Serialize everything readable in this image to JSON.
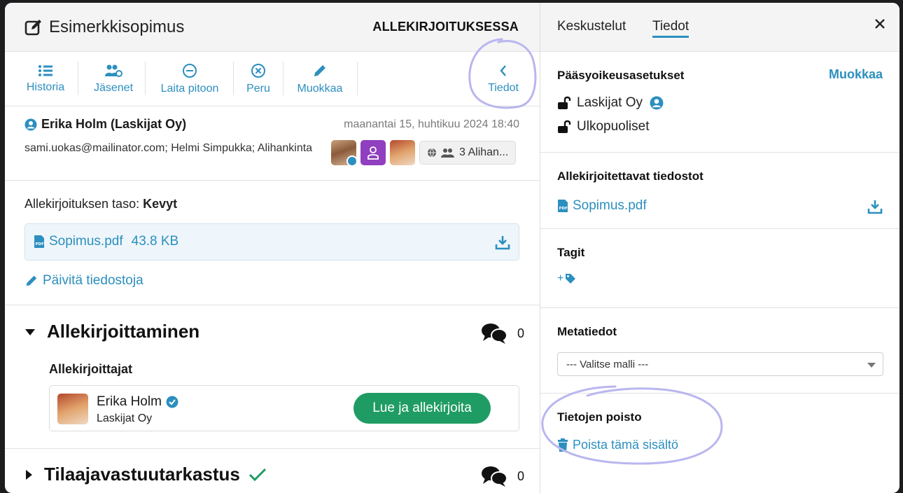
{
  "header": {
    "title": "Esimerkkisopimus",
    "status": "ALLEKIRJOITUKSESSA"
  },
  "toolbar": {
    "items": [
      {
        "label": "Historia",
        "icon": "list-icon"
      },
      {
        "label": "Jäsenet",
        "icon": "users-gear-icon"
      },
      {
        "label": "Laita pitoon",
        "icon": "minus-circle-icon"
      },
      {
        "label": "Peru",
        "icon": "x-circle-icon"
      },
      {
        "label": "Muokkaa",
        "icon": "pencil-icon"
      }
    ],
    "details_label": "Tiedot"
  },
  "message": {
    "sender": "Erika Holm (Laskijat Oy)",
    "date": "maanantai 15, huhtikuu 2024 18:40",
    "recipients": "sami.uokas@mailinator.com;  Helmi Simpukka; Alihankinta",
    "group_chip": "3 Alihan..."
  },
  "document": {
    "level_label": "Allekirjoituksen taso:",
    "level_value": "Kevyt",
    "file_name": "Sopimus.pdf",
    "file_size": "43.8 KB",
    "update_label": "Päivitä tiedostoja"
  },
  "signing": {
    "title": "Allekirjoittaminen",
    "comment_count": "0",
    "signers_label": "Allekirjoittajat",
    "signer_name": "Erika Holm",
    "signer_org": "Laskijat Oy",
    "sign_button": "Lue ja allekirjoita"
  },
  "review": {
    "title": "Tilaajavastuutarkastus",
    "comment_count": "0"
  },
  "sidebar": {
    "tabs": [
      "Keskustelut",
      "Tiedot"
    ],
    "active_tab": "Tiedot",
    "access": {
      "title": "Pääsyoikeusasetukset",
      "edit_label": "Muokkaa",
      "rows": [
        "Laskijat Oy",
        "Ulkopuoliset"
      ]
    },
    "files": {
      "title": "Allekirjoitettavat tiedostot",
      "file_name": "Sopimus.pdf"
    },
    "tags": {
      "title": "Tagit",
      "add_label": "+"
    },
    "metadata": {
      "title": "Metatiedot",
      "select_value": "--- Valitse malli ---"
    },
    "deletion": {
      "title": "Tietojen poisto",
      "delete_label": "Poista tämä sisältö"
    }
  },
  "colors": {
    "accent": "#2c8fbf",
    "success": "#1f9c63",
    "annotation": "#b9b6ef"
  }
}
